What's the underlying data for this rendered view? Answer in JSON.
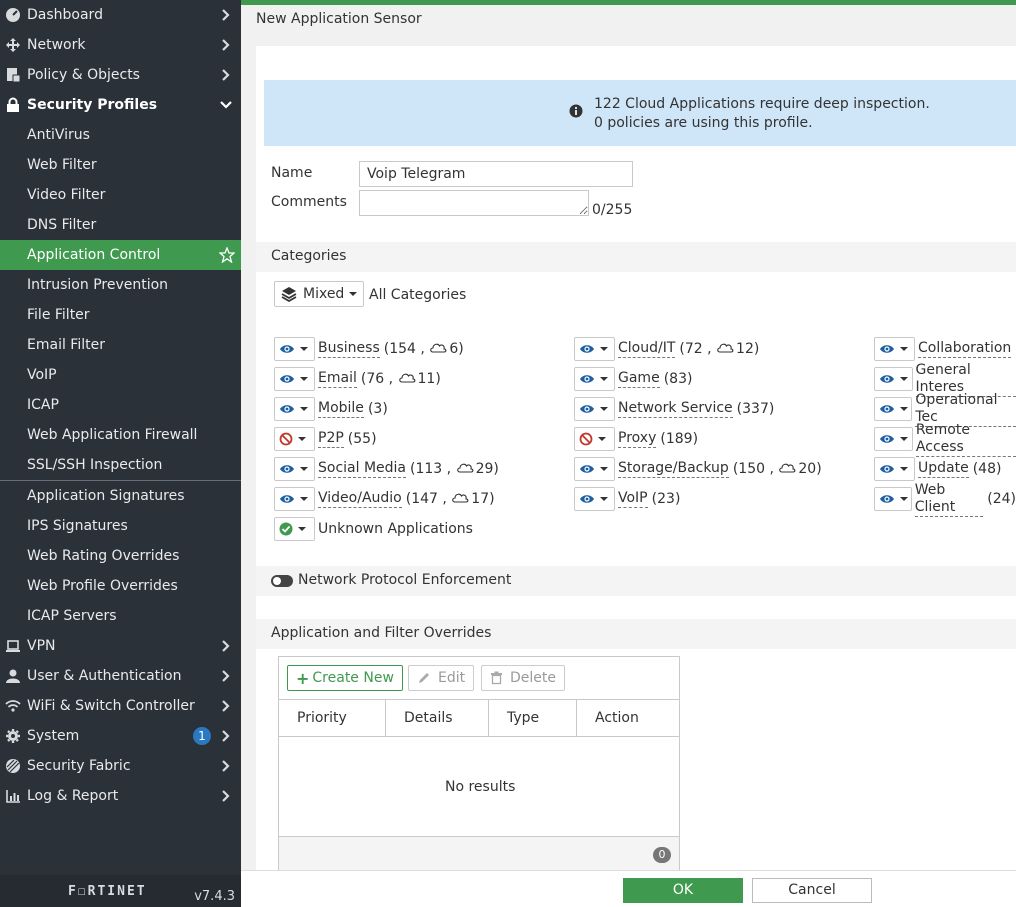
{
  "sidebar": {
    "items": [
      {
        "label": "Dashboard",
        "icon": "dashboard-icon"
      },
      {
        "label": "Network",
        "icon": "network-icon"
      },
      {
        "label": "Policy & Objects",
        "icon": "policy-icon"
      },
      {
        "label": "Security Profiles",
        "icon": "lock-icon"
      },
      {
        "label": "AntiVirus"
      },
      {
        "label": "Web Filter"
      },
      {
        "label": "Video Filter"
      },
      {
        "label": "DNS Filter"
      },
      {
        "label": "Application Control"
      },
      {
        "label": "Intrusion Prevention"
      },
      {
        "label": "File Filter"
      },
      {
        "label": "Email Filter"
      },
      {
        "label": "VoIP"
      },
      {
        "label": "ICAP"
      },
      {
        "label": "Web Application Firewall"
      },
      {
        "label": "SSL/SSH Inspection"
      },
      {
        "label": "Application Signatures"
      },
      {
        "label": "IPS Signatures"
      },
      {
        "label": "Web Rating Overrides"
      },
      {
        "label": "Web Profile Overrides"
      },
      {
        "label": "ICAP Servers"
      },
      {
        "label": "VPN",
        "icon": "laptop-icon"
      },
      {
        "label": "User & Authentication",
        "icon": "user-icon"
      },
      {
        "label": "WiFi & Switch Controller",
        "icon": "wifi-icon"
      },
      {
        "label": "System",
        "icon": "gear-icon",
        "badge": "1"
      },
      {
        "label": "Security Fabric",
        "icon": "fabric-icon"
      },
      {
        "label": "Log & Report",
        "icon": "chart-icon"
      }
    ],
    "brand": "F☐RTINET",
    "version": "v7.4.3"
  },
  "colors": {
    "accent": "#3f9a4f",
    "info_bg": "#cfe6f8",
    "sidebar_bg": "#2b3139",
    "block": "#c0392b"
  },
  "page": {
    "title": "New Application Sensor"
  },
  "info": {
    "line1": "122 Cloud Applications require deep inspection.",
    "line2": "0 policies are using this profile."
  },
  "form": {
    "name_label": "Name",
    "name_value": "Voip Telegram",
    "comments_label": "Comments",
    "comments_value": "",
    "comments_counter": "0/255"
  },
  "categories": {
    "header": "Categories",
    "mode_label": "Mixed",
    "all_label": "All Categories",
    "items": [
      {
        "name": "Business",
        "count": "154",
        "cloud": "6",
        "action": "monitor"
      },
      {
        "name": "Cloud/IT",
        "count": "72",
        "cloud": "12",
        "action": "monitor"
      },
      {
        "name": "Collaboration",
        "count": "(",
        "cloud": "",
        "action": "monitor"
      },
      {
        "name": "Email",
        "count": "76",
        "cloud": "11",
        "action": "monitor"
      },
      {
        "name": "Game",
        "count": "83",
        "cloud": "",
        "action": "monitor"
      },
      {
        "name": "General Interes",
        "count": "",
        "cloud": "",
        "action": "monitor"
      },
      {
        "name": "Mobile",
        "count": "3",
        "cloud": "",
        "action": "monitor"
      },
      {
        "name": "Network Service",
        "count": "337",
        "cloud": "",
        "action": "monitor"
      },
      {
        "name": "Operational Tec",
        "count": "",
        "cloud": "",
        "action": "monitor"
      },
      {
        "name": "P2P",
        "count": "55",
        "cloud": "",
        "action": "block"
      },
      {
        "name": "Proxy",
        "count": "189",
        "cloud": "",
        "action": "block"
      },
      {
        "name": "Remote Access",
        "count": "",
        "cloud": "",
        "action": "monitor"
      },
      {
        "name": "Social Media",
        "count": "113",
        "cloud": "29",
        "action": "monitor"
      },
      {
        "name": "Storage/Backup",
        "count": "150",
        "cloud": "20",
        "action": "monitor"
      },
      {
        "name": "Update",
        "count": "48",
        "cloud": "",
        "action": "monitor"
      },
      {
        "name": "Video/Audio",
        "count": "147",
        "cloud": "17",
        "action": "monitor"
      },
      {
        "name": "VoIP",
        "count": "23",
        "cloud": "",
        "action": "monitor"
      },
      {
        "name": "Web Client",
        "count": "24",
        "cloud": "",
        "action": "monitor"
      },
      {
        "name": "Unknown Applications",
        "count": "",
        "cloud": "",
        "action": "allow"
      }
    ]
  },
  "protocol": {
    "label": "Network Protocol Enforcement",
    "enabled": false
  },
  "overrides": {
    "header": "Application and Filter Overrides",
    "create_label": "Create New",
    "edit_label": "Edit",
    "delete_label": "Delete",
    "columns": [
      "Priority",
      "Details",
      "Type",
      "Action"
    ],
    "empty_text": "No results",
    "count": "0"
  },
  "footer": {
    "ok_label": "OK",
    "cancel_label": "Cancel"
  }
}
